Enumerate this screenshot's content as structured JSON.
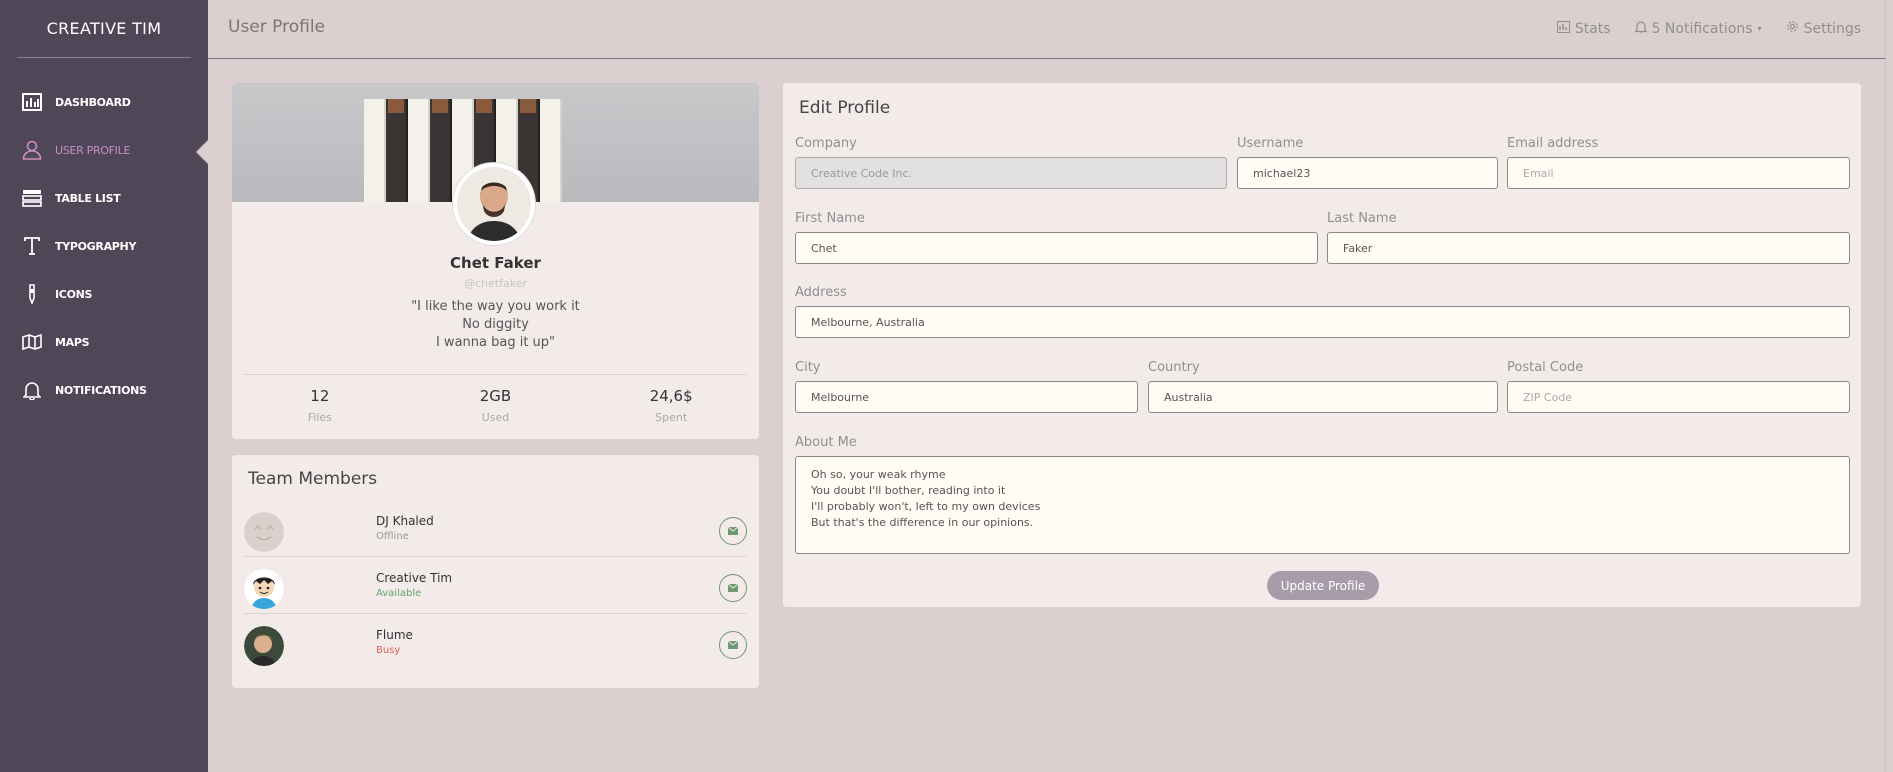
{
  "sidebar": {
    "brand": "CREATIVE TIM",
    "items": [
      {
        "label": "DASHBOARD",
        "icon": "chart-icon"
      },
      {
        "label": "USER PROFILE",
        "icon": "user-icon"
      },
      {
        "label": "TABLE LIST",
        "icon": "table-icon"
      },
      {
        "label": "TYPOGRAPHY",
        "icon": "type-icon"
      },
      {
        "label": "ICONS",
        "icon": "pencil-icon"
      },
      {
        "label": "MAPS",
        "icon": "map-icon"
      },
      {
        "label": "NOTIFICATIONS",
        "icon": "bell-icon"
      }
    ],
    "active_index": 1
  },
  "header": {
    "title": "User Profile",
    "stats": "Stats",
    "notifications": "5 Notifications",
    "settings": "Settings"
  },
  "user_card": {
    "name": "Chet Faker",
    "handle": "@chetfaker",
    "quote_lines": [
      "\"I like the way you work it",
      "No diggity",
      "I wanna bag it up\""
    ],
    "stats": [
      {
        "value": "12",
        "label": "Files"
      },
      {
        "value": "2GB",
        "label": "Used"
      },
      {
        "value": "24,6$",
        "label": "Spent"
      }
    ]
  },
  "team": {
    "title": "Team Members",
    "members": [
      {
        "name": "DJ Khaled",
        "status": "Offline",
        "status_color": "#9a9a9a"
      },
      {
        "name": "Creative Tim",
        "status": "Available",
        "status_color": "#6aa56a"
      },
      {
        "name": "Flume",
        "status": "Busy",
        "status_color": "#e0605a"
      }
    ]
  },
  "edit_profile": {
    "title": "Edit Profile",
    "company": {
      "label": "Company",
      "value": "Creative Code Inc."
    },
    "username": {
      "label": "Username",
      "value": "michael23"
    },
    "email": {
      "label": "Email address",
      "placeholder": "Email"
    },
    "first_name": {
      "label": "First Name",
      "value": "Chet"
    },
    "last_name": {
      "label": "Last Name",
      "value": "Faker"
    },
    "address": {
      "label": "Address",
      "value": "Melbourne, Australia"
    },
    "city": {
      "label": "City",
      "value": "Melbourne"
    },
    "country": {
      "label": "Country",
      "value": "Australia"
    },
    "postal": {
      "label": "Postal Code",
      "placeholder": "ZIP Code"
    },
    "about": {
      "label": "About Me",
      "value": "Oh so, your weak rhyme\nYou doubt I'll bother, reading into it\nI'll probably won't, left to my own devices\nBut that's the difference in our opinions."
    },
    "submit": "Update Profile"
  }
}
